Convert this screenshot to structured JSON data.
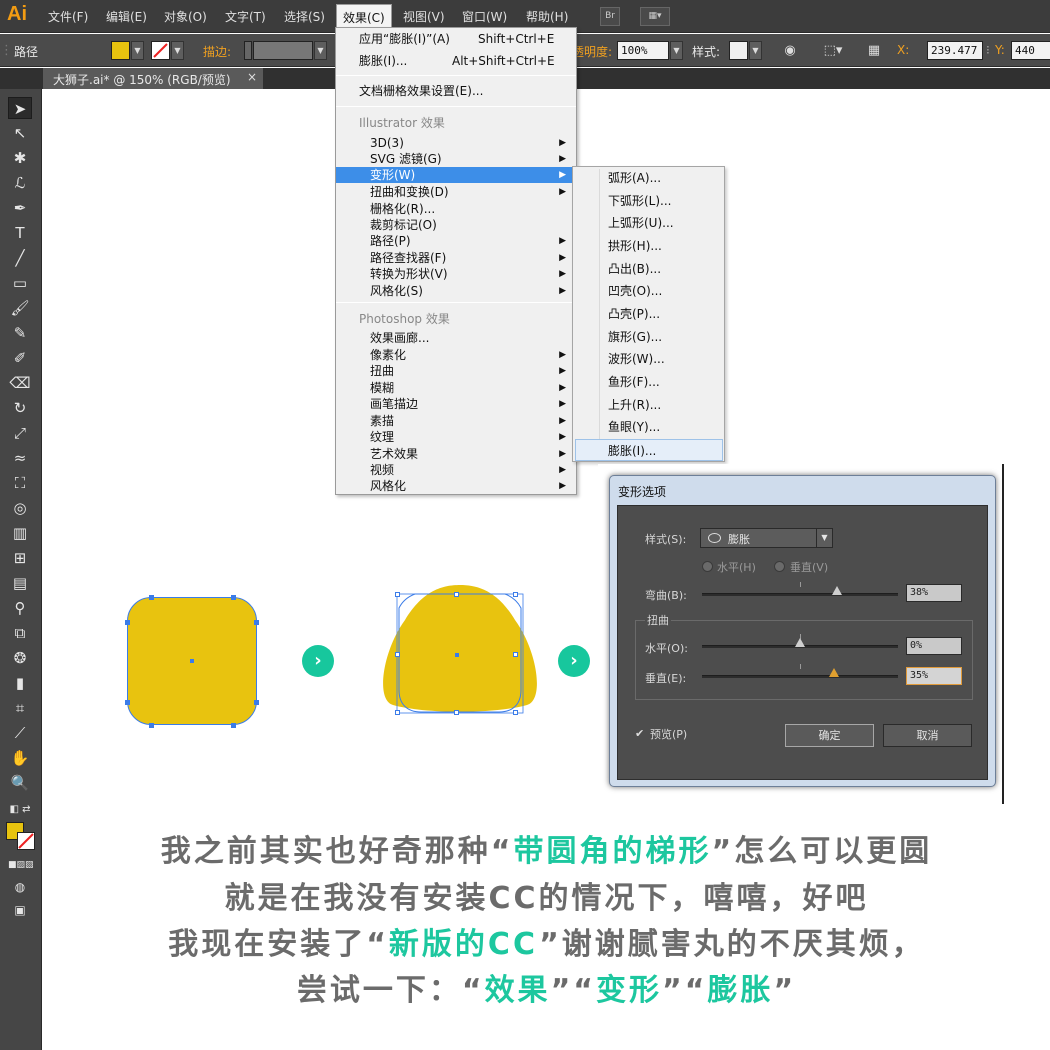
{
  "app": {
    "logo": "Ai"
  },
  "menubar": {
    "items": [
      "文件(F)",
      "编辑(E)",
      "对象(O)",
      "文字(T)",
      "选择(S)",
      "效果(C)",
      "视图(V)",
      "窗口(W)",
      "帮助(H)"
    ],
    "bridge_label": "Br"
  },
  "controlbar": {
    "selection_label": "路径",
    "stroke_label": "描边:",
    "opacity_label": "不透明度:",
    "opacity_value": "100%",
    "style_label": "样式:",
    "x_label": "X:",
    "x_value": "239.477",
    "y_label": "Y:",
    "y_value": "440"
  },
  "tab": {
    "title": "大狮子.ai* @ 150% (RGB/预览)",
    "close": "×"
  },
  "effect_menu": {
    "apply_last_label": "应用“膨胀(I)”(A)",
    "apply_last_shortcut": "Shift+Ctrl+E",
    "last_label": "膨胀(I)...",
    "last_shortcut": "Alt+Shift+Ctrl+E",
    "raster_settings": "文档栅格效果设置(E)...",
    "illustrator_header": "Illustrator 效果",
    "illustrator_items": [
      "3D(3)",
      "SVG 滤镜(G)",
      "变形(W)",
      "扭曲和变换(D)",
      "栅格化(R)...",
      "裁剪标记(O)",
      "路径(P)",
      "路径查找器(F)",
      "转换为形状(V)",
      "风格化(S)"
    ],
    "photoshop_header": "Photoshop 效果",
    "photoshop_items": [
      "效果画廊...",
      "像素化",
      "扭曲",
      "模糊",
      "画笔描边",
      "素描",
      "纹理",
      "艺术效果",
      "视频",
      "风格化"
    ]
  },
  "warp_menu": {
    "items": [
      "弧形(A)...",
      "下弧形(L)...",
      "上弧形(U)...",
      "拱形(H)...",
      "凸出(B)...",
      "凹壳(O)...",
      "凸壳(P)...",
      "旗形(G)...",
      "波形(W)...",
      "鱼形(F)...",
      "上升(R)...",
      "鱼眼(Y)...",
      "膨胀(I)..."
    ]
  },
  "dialog": {
    "title": "变形选项",
    "style_label": "样式(S):",
    "style_value": "膨胀",
    "horizontal_radio": "水平(H)",
    "vertical_radio": "垂直(V)",
    "bend_label": "弯曲(B):",
    "bend_value": "38%",
    "distort_group": "扭曲",
    "dist_h_label": "水平(O):",
    "dist_h_value": "0%",
    "dist_v_label": "垂直(E):",
    "dist_v_value": "35%",
    "preview_label": "预览(P)",
    "ok_label": "确定",
    "cancel_label": "取消",
    "bend_fraction": 0.69,
    "dist_h_fraction": 0.5,
    "dist_v_fraction": 0.675
  },
  "colors": {
    "shape_fill": "#E8C30F",
    "selection_blue": "#3B7CE8",
    "accent_green": "#17C79D",
    "menu_highlight": "#3D8EE8"
  },
  "caption": {
    "line1_a": "我之前其实也好奇那种“",
    "line1_hl": "带圆角的梯形",
    "line1_b": "”怎么可以更圆",
    "line2": "就是在我没有安装CC的情况下，嘻嘻，好吧",
    "line3_a": "我现在安装了“",
    "line3_hl": "新版的CC",
    "line3_b": "”谢谢腻害丸的不厌其烦，",
    "line4_a": "尝试一下：“",
    "line4_hl1": "效果",
    "line4_m1": "”“",
    "line4_hl2": "变形",
    "line4_m2": "”“",
    "line4_hl3": "膨胀",
    "line4_b": "”"
  }
}
